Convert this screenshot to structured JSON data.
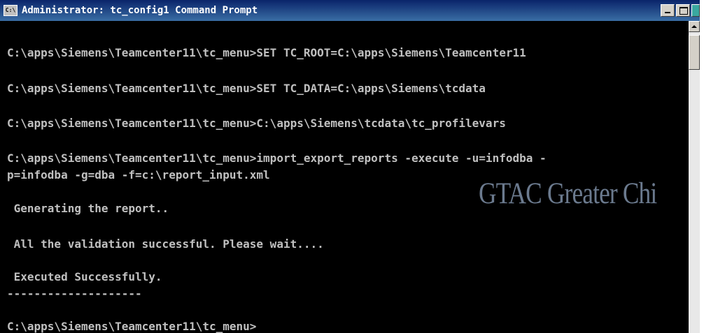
{
  "window": {
    "title": "Administrator: tc_config1 Command Prompt",
    "icon_text": "C:\\",
    "icon": "cmd-icon"
  },
  "console": {
    "lines": [
      "C:\\apps\\Siemens\\Teamcenter11\\tc_menu>SET TC_ROOT=C:\\apps\\Siemens\\Teamcenter11",
      "C:\\apps\\Siemens\\Teamcenter11\\tc_menu>SET TC_DATA=C:\\apps\\Siemens\\tcdata",
      "C:\\apps\\Siemens\\Teamcenter11\\tc_menu>C:\\apps\\Siemens\\tcdata\\tc_profilevars",
      "C:\\apps\\Siemens\\Teamcenter11\\tc_menu>import_export_reports -execute -u=infodba -",
      "p=infodba -g=dba -f=c:\\report_input.xml",
      " Generating the report..",
      " All the validation successful. Please wait....",
      " Executed Successfully.",
      "C:\\apps\\Siemens\\Teamcenter11\\tc_menu>"
    ],
    "separator": "--------------------"
  },
  "watermark": {
    "text": "GTAC Greater Chi"
  },
  "colors": {
    "background": "#000000",
    "text": "#c0c0c0",
    "titlebar": "#0a246a"
  }
}
